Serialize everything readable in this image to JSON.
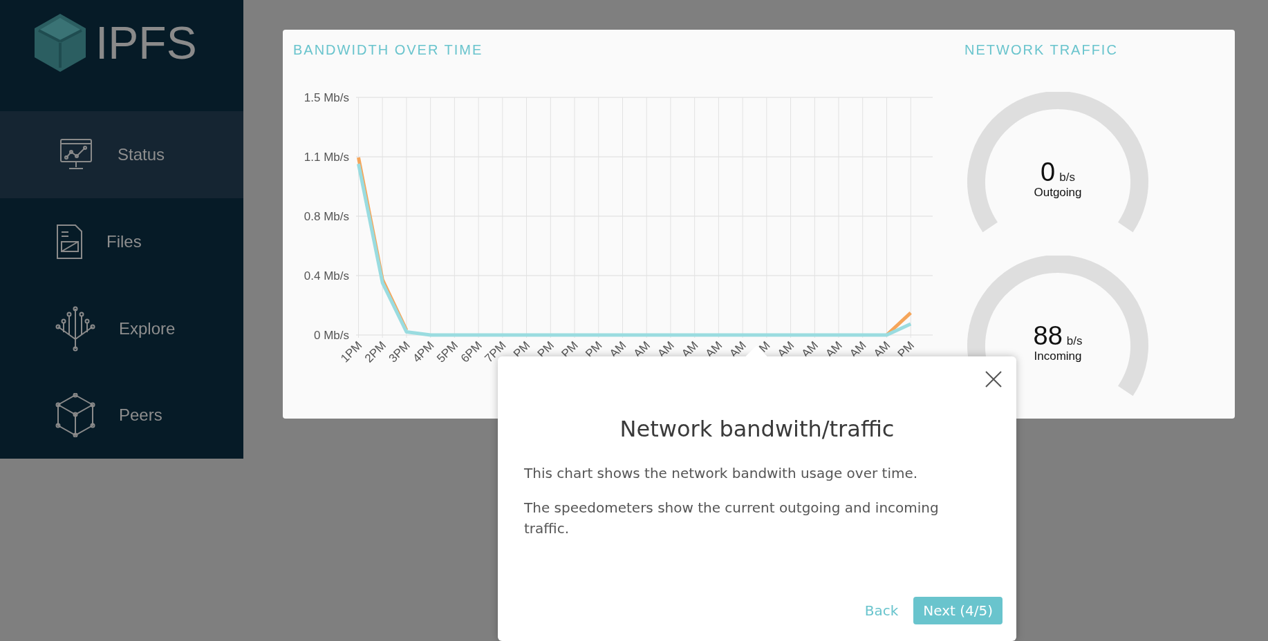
{
  "sidebar": {
    "logo": {
      "text": "IPFS"
    },
    "items": [
      {
        "label": "Status",
        "kind": "status",
        "selected": true
      },
      {
        "label": "Files",
        "kind": "files",
        "selected": false
      },
      {
        "label": "Explore",
        "kind": "explore",
        "selected": false
      },
      {
        "label": "Peers",
        "kind": "peers",
        "selected": false
      }
    ]
  },
  "bandwidth": {
    "title": "BANDWIDTH OVER TIME",
    "chart_data": {
      "type": "line",
      "categories": [
        "1PM",
        "2PM",
        "3PM",
        "4PM",
        "5PM",
        "6PM",
        "7PM",
        "PM",
        "PM",
        "PM",
        "PM",
        "AM",
        "AM",
        "AM",
        "AM",
        "AM",
        "AM",
        "M",
        "AM",
        "AM",
        "AM",
        "AM",
        "AM",
        "PM"
      ],
      "series": [
        {
          "color": "#f5a55a",
          "values": [
            1.12,
            0.35,
            0.03,
            null,
            null,
            null,
            null,
            null,
            null,
            null,
            null,
            null,
            null,
            null,
            null,
            null,
            null,
            null,
            null,
            null,
            null,
            null,
            0,
            0.14
          ]
        },
        {
          "color": "#9adce0",
          "values": [
            1.08,
            0.33,
            0.02,
            0,
            0,
            0,
            0,
            0,
            0,
            0,
            0,
            0,
            0,
            0,
            0,
            0,
            0,
            0,
            0,
            0,
            0,
            0,
            0,
            0.07
          ]
        }
      ],
      "ylim": [
        0,
        1.5
      ],
      "grid": true,
      "yticks": [
        {
          "value": 0,
          "label": "0 Mb/s"
        },
        {
          "value": 0.375,
          "label": "0.4 Mb/s"
        },
        {
          "value": 0.75,
          "label": "0.8 Mb/s"
        },
        {
          "value": 1.125,
          "label": "1.1 Mb/s"
        },
        {
          "value": 1.5,
          "label": "1.5 Mb/s"
        }
      ]
    }
  },
  "traffic": {
    "title": "NETWORK TRAFFIC",
    "gauges": [
      {
        "value": "0",
        "unit": "b/s",
        "label": "Outgoing"
      },
      {
        "value": "88",
        "unit": "b/s",
        "label": "Incoming"
      }
    ]
  },
  "tour": {
    "title": "Network bandwith/traffic",
    "paragraphs": [
      "This chart shows the network bandwith usage over time.",
      "The speedometers show the current outgoing and incoming traffic."
    ],
    "back": "Back",
    "next": "Next (4/5)"
  }
}
